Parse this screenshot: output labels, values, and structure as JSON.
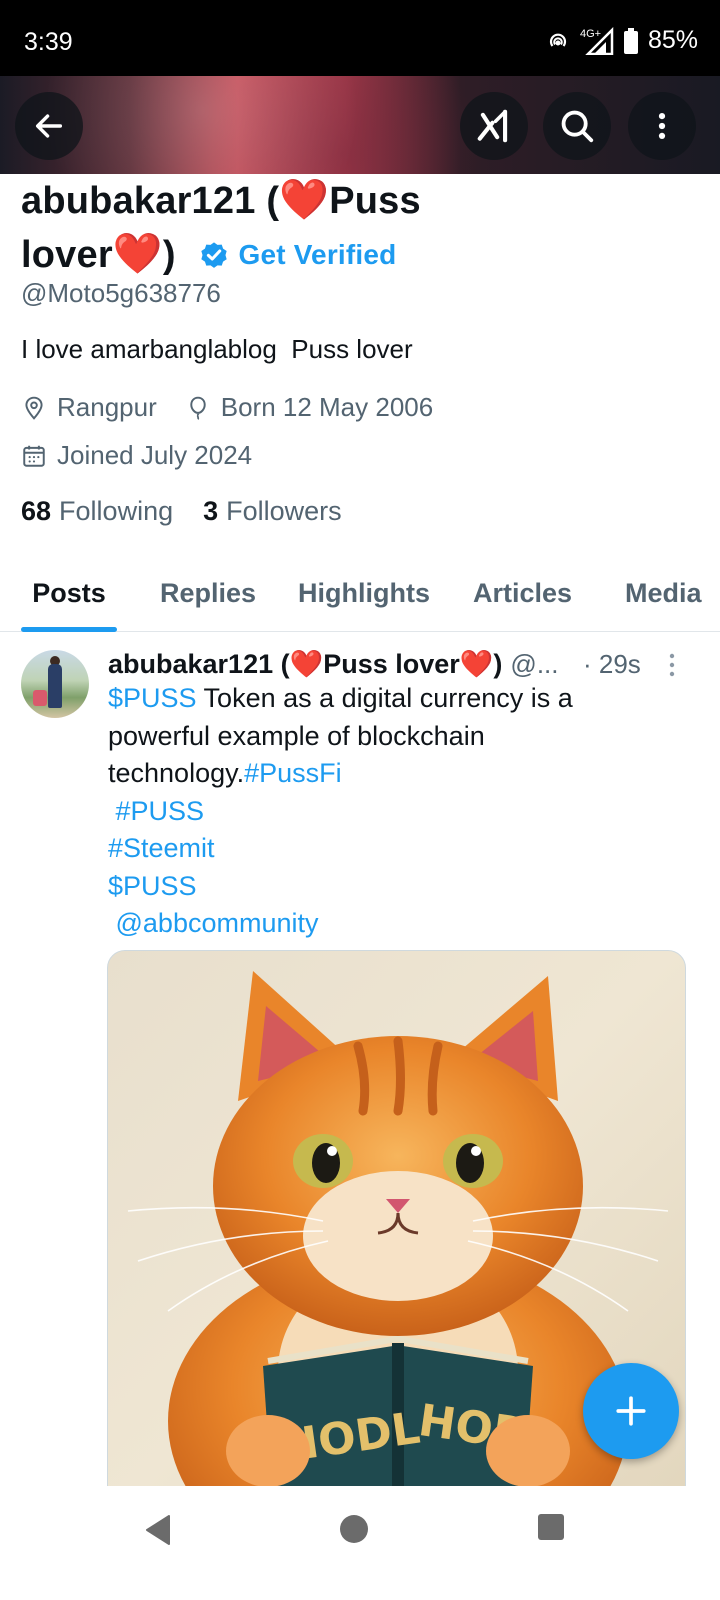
{
  "status_bar": {
    "time": "3:39",
    "network": "4G+",
    "battery": "85%"
  },
  "profile": {
    "name_part1": "abubakar121 (",
    "name_part2": "Puss",
    "name_part3": "lover",
    "name_part4": ")",
    "heart": "❤️",
    "get_verified": "Get Verified",
    "handle": "@Moto5g638776",
    "bio": "I love amarbanglablog  Puss lover",
    "location": "Rangpur",
    "born": "Born 12 May 2006",
    "joined": "Joined July 2024",
    "following_count": "68",
    "following_label": "Following",
    "followers_count": "3",
    "followers_label": "Followers"
  },
  "tabs": [
    {
      "label": "Posts",
      "active": true
    },
    {
      "label": "Replies",
      "active": false
    },
    {
      "label": "Highlights",
      "active": false
    },
    {
      "label": "Articles",
      "active": false
    },
    {
      "label": "Media",
      "active": false
    }
  ],
  "tweet": {
    "name_part1": "abubakar121 (",
    "name_part2": "Puss lover",
    "name_part3": ")",
    "handle": "@...",
    "time": "· 29s",
    "text_link1": "$PUSS",
    "text_body1": " Token as a digital currency is a",
    "text_body2": "powerful example of blockchain",
    "text_body3": "technology.",
    "text_link2": "#PussFi",
    "text_link3": " #PUSS",
    "text_link4": "#Steemit",
    "text_link5": "$PUSS",
    "text_link6": " @abbcommunity",
    "image_text_left": "HODL",
    "image_text_right": "HODL"
  },
  "icons": {
    "back": "arrow-left-icon",
    "grok": "grok-icon",
    "search": "search-icon",
    "more": "more-vertical-icon",
    "location": "location-pin-icon",
    "birthday": "balloon-icon",
    "calendar": "calendar-icon",
    "verified": "verified-badge-icon",
    "compose": "plus-icon"
  },
  "colors": {
    "accent": "#1d9bf0",
    "heart": "#e3102b",
    "text": "#0f1419",
    "secondary": "#536471"
  }
}
